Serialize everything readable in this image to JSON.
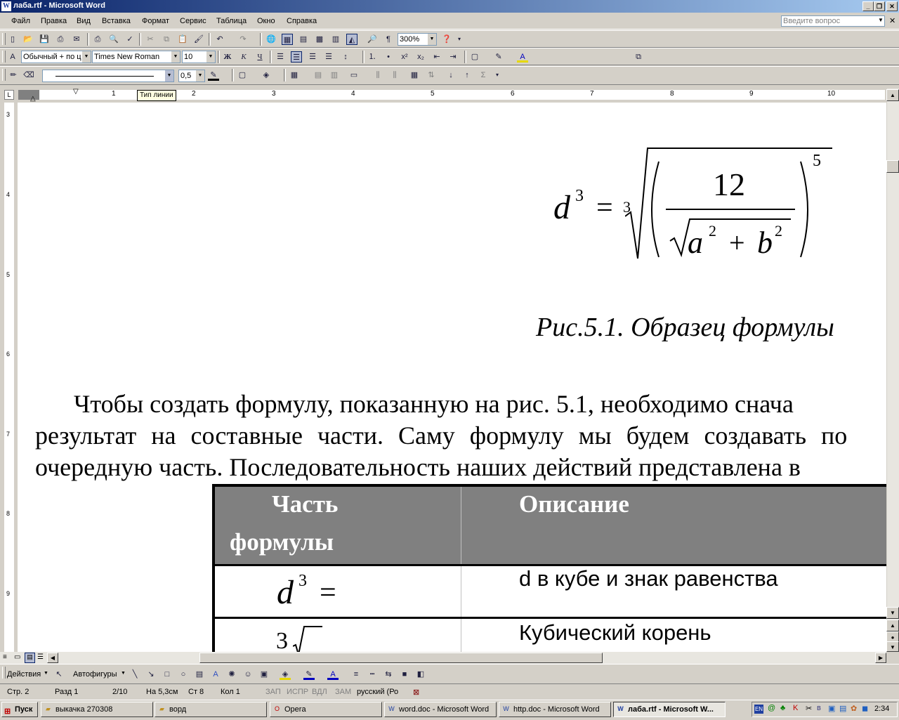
{
  "window": {
    "title": "лаба.rtf - Microsoft Word"
  },
  "menu": {
    "items": [
      "Файл",
      "Правка",
      "Вид",
      "Вставка",
      "Формат",
      "Сервис",
      "Таблица",
      "Окно",
      "Справка"
    ],
    "help_placeholder": "Введите вопрос"
  },
  "toolbar": {
    "zoom": "300%",
    "style": "Обычный + по ц",
    "font": "Times New Roman",
    "size": "10",
    "bold": "Ж",
    "italic": "К",
    "underline": "Ч",
    "line_weight": "0,5"
  },
  "ruler": {
    "numbers": [
      "1",
      "2",
      "3",
      "4",
      "5",
      "6",
      "7",
      "8",
      "9",
      "10"
    ],
    "tooltip": "Тип линии",
    "vnumbers": [
      "3",
      "4",
      "5",
      "6",
      "7",
      "8",
      "9"
    ]
  },
  "document": {
    "formula": {
      "lhs": "d",
      "lhs_exp": "3",
      "root_index": "3",
      "numerator": "12",
      "a": "a",
      "b": "b",
      "sq": "2",
      "outer_exp": "5",
      "plus": "+",
      "eq": "="
    },
    "caption": "Рис.5.1. Образец формулы",
    "paragraph": [
      "Чтобы создать формулу, показанную на рис. 5.1, необходимо снача",
      "результат на составные части. Саму формулу мы будем создавать по",
      "очередную часть. Последовательность наших действий представлена в"
    ],
    "table": {
      "headers": [
        "Часть",
        "формулы",
        "Описание"
      ],
      "rows": [
        {
          "part_index": "3",
          "description": "d в кубе и знак равенства"
        },
        {
          "part_index": "3",
          "description": "Кубический корень"
        }
      ]
    }
  },
  "drawing": {
    "actions": "Действия",
    "autoshapes": "Автофигуры"
  },
  "status": {
    "page": "Стр. 2",
    "section": "Разд 1",
    "pages": "2/10",
    "at": "На 5,3см",
    "line": "Ст 8",
    "col": "Кол 1",
    "rec": "ЗАП",
    "trk": "ИСПР",
    "ext": "ВДЛ",
    "ovr": "ЗАМ",
    "lang": "русский (Ро"
  },
  "taskbar": {
    "start": "Пуск",
    "tasks": [
      "выкачка 270308",
      "ворд",
      "Opera",
      "word.doc - Microsoft Word",
      "http.doc - Microsoft Word",
      "лаба.rtf - Microsoft W..."
    ],
    "lang": "EN",
    "clock": "2:34"
  }
}
